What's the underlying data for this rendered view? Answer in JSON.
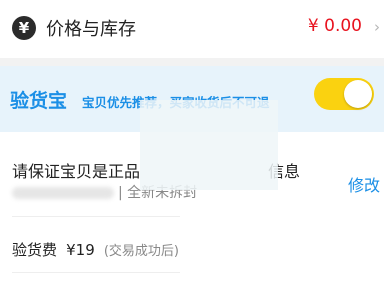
{
  "price_row": {
    "icon": "yen-icon",
    "icon_glyph": "¥",
    "title": "价格与库存",
    "value": "¥ 0.00",
    "chevron": "›"
  },
  "inspection": {
    "title": "验货宝",
    "desc": "宝贝优先推荐，买家收货后不可退",
    "toggle_on": true,
    "toggle_color": "#fad210"
  },
  "guarantee": {
    "text_left": "请保证宝贝是正品",
    "text_right": "信息",
    "edit_label": "修改",
    "subtitle": "| 全新未拆封"
  },
  "fee": {
    "label": "验货费",
    "value": "¥19",
    "note": "(交易成功后)"
  },
  "colors": {
    "accent_blue": "#1b8fe6",
    "price_red": "#e8131f",
    "banner_bg": "#e7f3fb"
  }
}
